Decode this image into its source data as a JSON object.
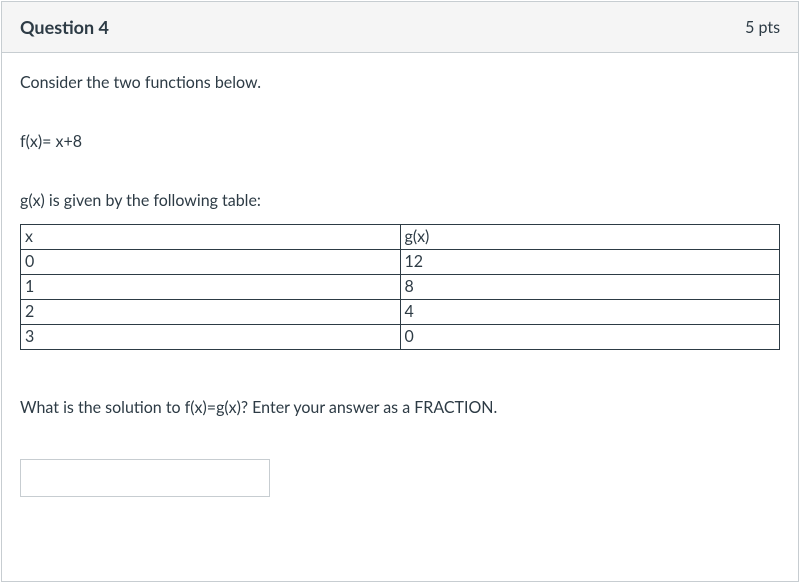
{
  "header": {
    "title": "Question 4",
    "points": "5 pts"
  },
  "body": {
    "intro": "Consider the two functions below.",
    "function_f": "f(x)= x+8",
    "table_intro": "g(x) is given by the following table:",
    "table": {
      "header": [
        "x",
        "g(x)"
      ],
      "rows": [
        [
          "0",
          "12"
        ],
        [
          "1",
          "8"
        ],
        [
          "2",
          "4"
        ],
        [
          "3",
          "0"
        ]
      ]
    },
    "final_prompt": "What is the solution to f(x)=g(x)? Enter your answer as a FRACTION.",
    "answer_value": ""
  }
}
